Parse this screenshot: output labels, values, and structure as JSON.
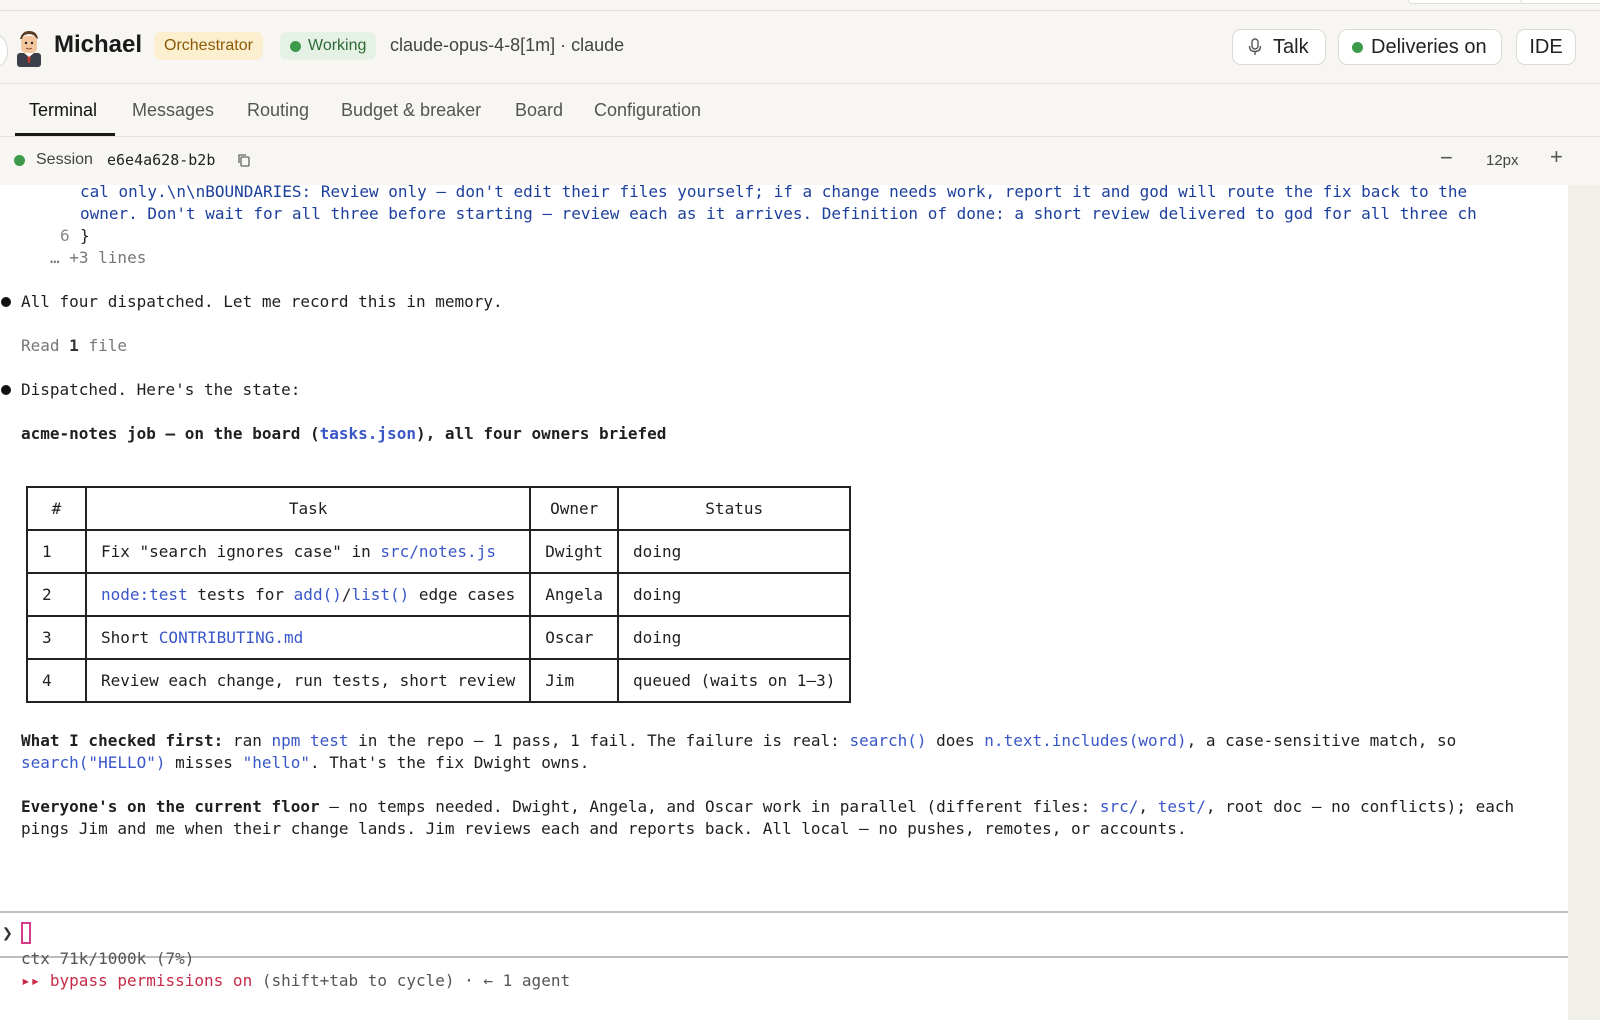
{
  "header": {
    "agent_name": "Michael",
    "role_badge": "Orchestrator",
    "status_badge": "Working",
    "model": "claude-opus-4-8[1m] · claude",
    "talk_label": "Talk",
    "deliveries_label": "Deliveries on",
    "ide_label": "IDE"
  },
  "tabs": [
    "Terminal",
    "Messages",
    "Routing",
    "Budget & breaker",
    "Board",
    "Configuration"
  ],
  "session": {
    "label": "Session",
    "id": "e6e4a628-b2b",
    "zoom": "12px"
  },
  "terminal": {
    "line_cont1": "cal only.\\n\\nBOUNDARIES: Review only — don't edit their files yourself; if a change needs work, report it and god will route the fix back to the",
    "line_cont2": "owner. Don't wait for all three before starting — review each as it arrives. Definition of done: a short review delivered to god for all three ch",
    "line6_num": "6",
    "line6_text": "}",
    "more_lines": "… +3 lines",
    "msg1": "All four dispatched. Let me record this in memory.",
    "read_pre": "Read ",
    "read_count": "1",
    "read_post": " file",
    "msg2": "Dispatched. Here's the state:",
    "job_pre": "acme-notes job — on the board (",
    "job_file": "tasks.json",
    "job_post": "), all four owners briefed",
    "table": {
      "headers": [
        "#",
        "Task",
        "Owner",
        "Status"
      ],
      "rows": [
        {
          "num": "1",
          "task_a": "Fix \"search ignores case\" in ",
          "task_code1": "src/notes.js",
          "owner": "Dwight",
          "status": "doing"
        },
        {
          "num": "2",
          "task_code1": "node:test",
          "task_b": " tests for ",
          "task_code2": "add()",
          "task_c": "/",
          "task_code3": "list()",
          "task_d": " edge cases",
          "owner": "Angela",
          "status": "doing"
        },
        {
          "num": "3",
          "task_a": "Short ",
          "task_code1": "CONTRIBUTING.md",
          "owner": "Oscar",
          "status": "doing"
        },
        {
          "num": "4",
          "task_a": "Review each change, run tests, short review",
          "owner": "Jim",
          "status": "queued (waits on 1–3)"
        }
      ]
    },
    "checked_label": "What I checked first:",
    "checked_a": " ran ",
    "checked_code1": "npm test",
    "checked_b": " in the repo — 1 pass, 1 fail. The failure is real: ",
    "checked_code2": "search()",
    "checked_c": " does ",
    "checked_code3": "n.text.includes(word)",
    "checked_d": ", a case-sensitive match, so",
    "checked2_code1": "search(\"HELLO\")",
    "checked2_a": " misses ",
    "checked2_code2": "\"hello\"",
    "checked2_b": ". That's the fix Dwight owns.",
    "floor_label": "Everyone's on the current floor",
    "floor_a": " — no temps needed. Dwight, Angela, and Oscar work in parallel (different files: ",
    "floor_code1": "src/",
    "floor_b": ", ",
    "floor_code2": "test/",
    "floor_c": ", root doc — no conflicts); each",
    "floor2": "pings Jim and me when their change lands. Jim reviews each and reports back. All local — no pushes, remotes, or accounts.",
    "prompt_symbol": "❯",
    "ctx": "ctx 71k/1000k (7%)",
    "perm_arrows": "▸▸",
    "perm_text": "bypass permissions on",
    "perm_hint": " (shift+tab to cycle) · ← 1 agent"
  },
  "colors": {
    "accent_green": "#3d9a4a",
    "role_bg": "#fbefcf",
    "code_blue": "#3a57c9",
    "permission_red": "#c72b47"
  }
}
